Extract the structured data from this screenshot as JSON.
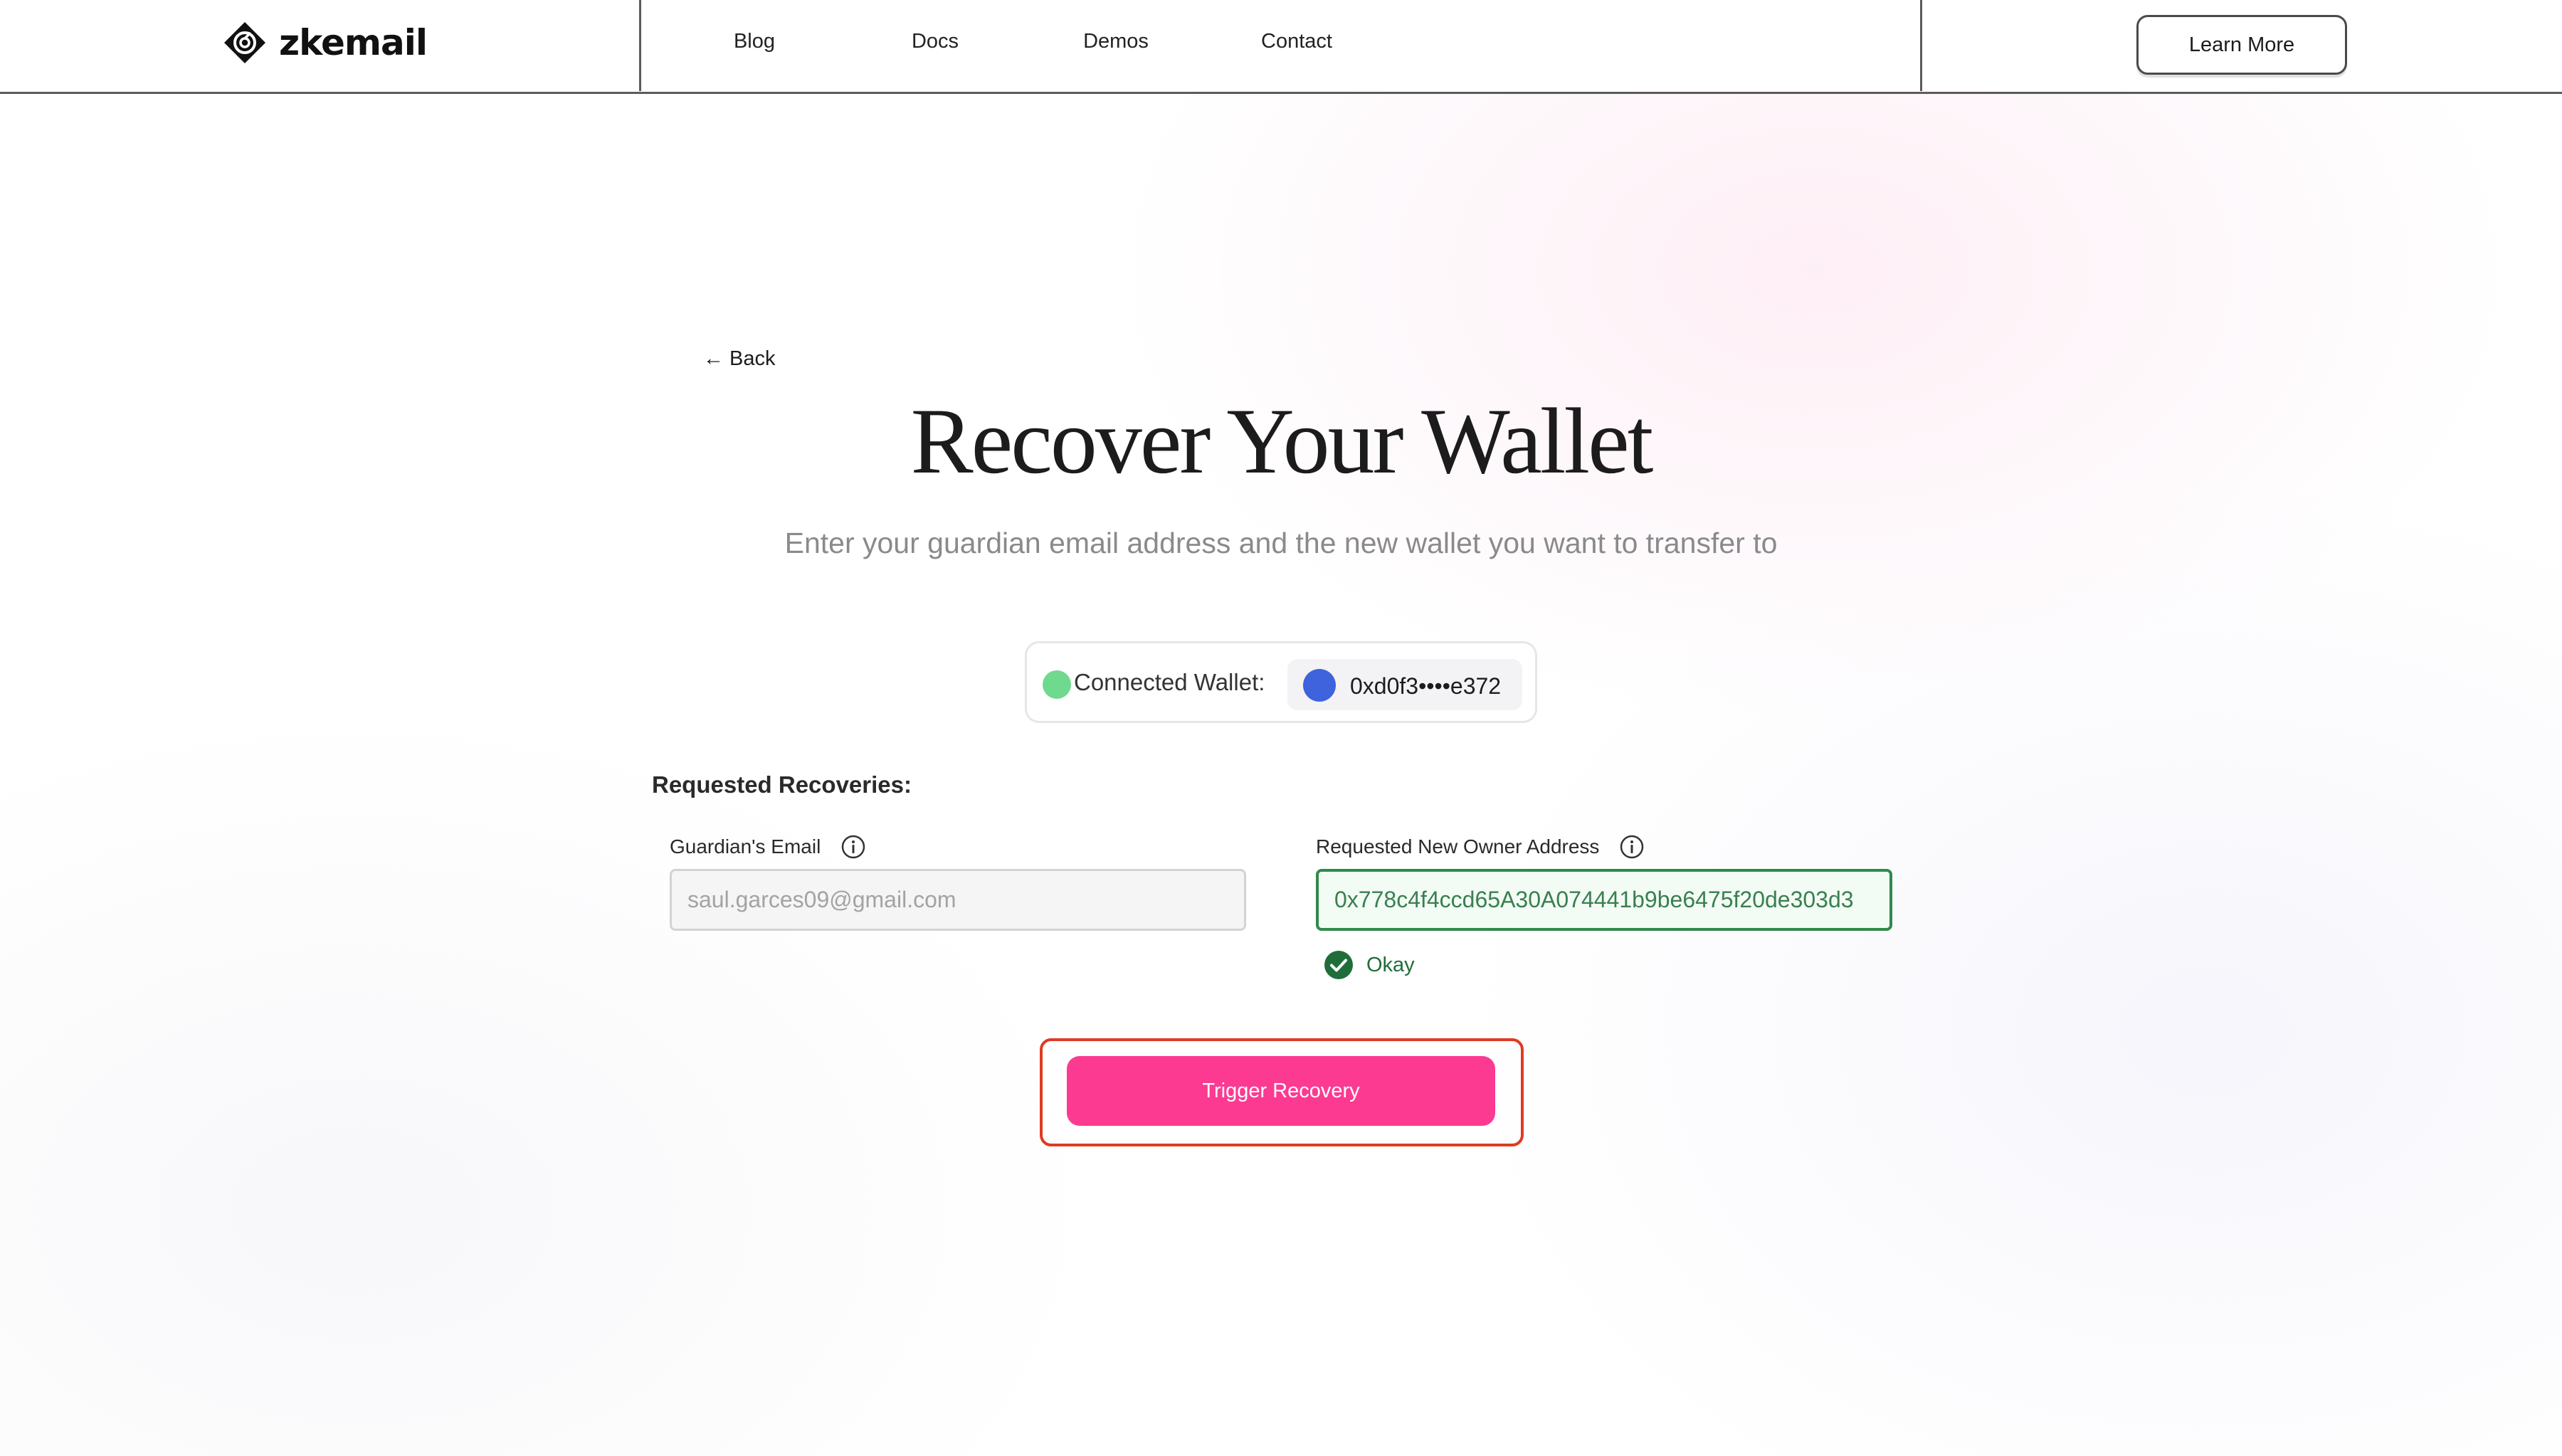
{
  "header": {
    "brand": "zkemail",
    "nav": [
      {
        "label": "Blog"
      },
      {
        "label": "Docs"
      },
      {
        "label": "Demos"
      },
      {
        "label": "Contact"
      }
    ],
    "cta_label": "Learn More"
  },
  "main": {
    "back_label": "← Back",
    "title": "Recover Your Wallet",
    "subtitle": "Enter your guardian email address and the new wallet you want to transfer to",
    "wallet": {
      "label": "Connected Wallet:",
      "address": "0xd0f3••••e372",
      "status_color": "#6fd98d",
      "avatar_color": "#3e63dd"
    },
    "section_label": "Requested Recoveries:",
    "guardian_email": {
      "label": "Guardian's Email",
      "placeholder": "saul.garces09@gmail.com",
      "value": ""
    },
    "new_owner": {
      "label": "Requested New Owner Address",
      "value": "0x778c4f4ccd65A30A074441b9be6475f20de303d3",
      "status": "Okay",
      "status_color": "#1f6e3a"
    },
    "trigger_label": "Trigger Recovery",
    "trigger_color": "#fd3a92",
    "highlight_color": "#e03a22"
  }
}
